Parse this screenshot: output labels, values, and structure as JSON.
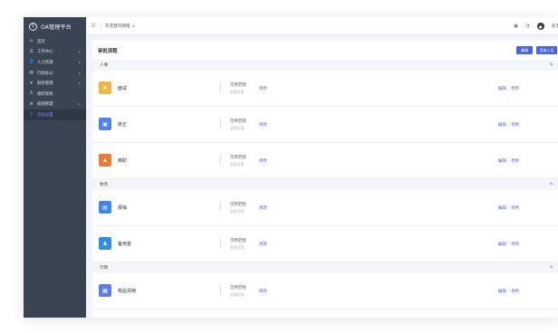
{
  "app": {
    "title": "OA管理平台",
    "logo_glyph": "⚲"
  },
  "sidebar": {
    "items": [
      {
        "icon": "⌂",
        "label": "首页",
        "arrow": ""
      },
      {
        "icon": "☰",
        "label": "工作中心",
        "arrow": "▸"
      },
      {
        "icon": "👤",
        "label": "人力资源",
        "arrow": "▸"
      },
      {
        "icon": "▤",
        "label": "行政办公",
        "arrow": "▸"
      },
      {
        "icon": "¥",
        "label": "财务管理",
        "arrow": "▸"
      },
      {
        "icon": "♁",
        "label": "组织架构",
        "arrow": ""
      },
      {
        "icon": "⚙",
        "label": "权限管理",
        "arrow": "▸"
      },
      {
        "icon": "⚠",
        "label": "流程设置",
        "arrow": ""
      }
    ],
    "active_index": 7
  },
  "topbar": {
    "menu_icon": "☰",
    "org_label": "东莞慧鸟网络",
    "caret": "▾",
    "icons": [
      "▣",
      "◔"
    ],
    "avatar_glyph": "●",
    "user_label": "多多"
  },
  "card": {
    "title": "审批流程",
    "edit_button": "编辑",
    "add_button": "添加人员"
  },
  "groups": [
    {
      "name": "人事",
      "pen": "✎",
      "pen_color": "#4a63e8",
      "rows": [
        {
          "icon": "♣",
          "color": "#f4b53a",
          "name": "面试",
          "scope_title": "可用范围",
          "scope_sub": "全部可用",
          "modify": "修改",
          "edit": "编辑",
          "disable": "停用"
        },
        {
          "icon": "▣",
          "color": "#4c84f0",
          "name": "转正",
          "scope_title": "可用范围",
          "scope_sub": "全部可用",
          "modify": "修改",
          "edit": "编辑",
          "disable": "停用"
        },
        {
          "icon": "♟",
          "color": "#f07a2c",
          "name": "离职",
          "scope_title": "可用范围",
          "scope_sub": "全部可用",
          "modify": "修改",
          "edit": "编辑",
          "disable": "停用"
        }
      ]
    },
    {
      "name": "财务",
      "pen": "✎",
      "pen_color": "#777777",
      "rows": [
        {
          "icon": "▤",
          "color": "#3d86f3",
          "name": "报销",
          "scope_title": "可用范围",
          "scope_sub": "全部可用",
          "modify": "修改",
          "edit": "编辑",
          "disable": "停用"
        },
        {
          "icon": "♟",
          "color": "#2f8fe8",
          "name": "备用金",
          "scope_title": "可用范围",
          "scope_sub": "全部可用",
          "modify": "修改",
          "edit": "编辑",
          "disable": "停用"
        }
      ]
    },
    {
      "name": "行政",
      "pen": "✎",
      "pen_color": "#777777",
      "rows": [
        {
          "icon": "▦",
          "color": "#5b7df0",
          "name": "物品领用",
          "scope_title": "可用范围",
          "scope_sub": "全部可用",
          "modify": "修改",
          "edit": "编辑",
          "disable": "停用"
        }
      ]
    }
  ],
  "separator": "|"
}
